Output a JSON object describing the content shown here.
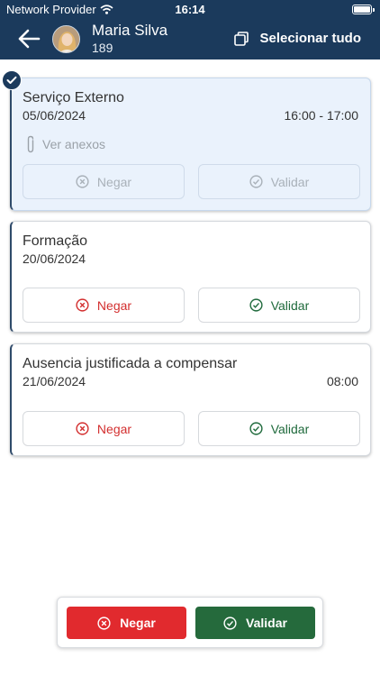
{
  "status_bar": {
    "carrier": "Network Provider",
    "time": "16:14"
  },
  "header": {
    "user_name": "Maria Silva",
    "user_code": "189",
    "select_all_label": "Selecionar tudo"
  },
  "requests": [
    {
      "title": "Serviço Externo",
      "date": "05/06/2024",
      "time": "16:00 - 17:00",
      "attachments_label": "Ver anexos",
      "deny_label": "Negar",
      "validate_label": "Validar",
      "selected": true
    },
    {
      "title": "Formação",
      "date": "20/06/2024",
      "deny_label": "Negar",
      "validate_label": "Validar",
      "selected": false
    },
    {
      "title": "Ausencia justificada a compensar",
      "date": "21/06/2024",
      "time": "08:00",
      "deny_label": "Negar",
      "validate_label": "Validar",
      "selected": false
    }
  ],
  "bulk_actions": {
    "deny_label": "Negar",
    "validate_label": "Validar"
  },
  "colors": {
    "header": "#1b3a5c",
    "deny": "#e12a2e",
    "validate": "#256a3c",
    "selected_bg": "#eaf2fc"
  }
}
